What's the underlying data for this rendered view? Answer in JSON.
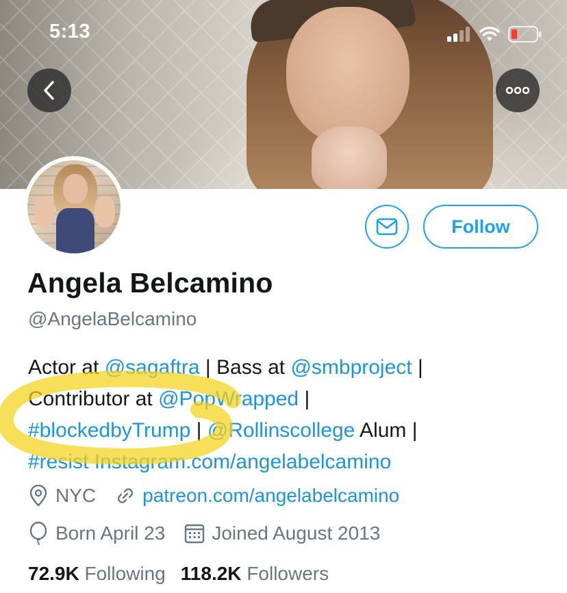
{
  "status_bar": {
    "time": "5:13"
  },
  "icons": {
    "back": "chevron-left-icon",
    "more": "more-horizontal-icon",
    "message": "envelope-icon",
    "location": "location-pin-icon",
    "link": "link-icon",
    "birthday": "balloon-icon",
    "joined": "calendar-icon",
    "signal": "signal-icon",
    "wifi": "wifi-icon",
    "battery": "battery-low-icon"
  },
  "colors": {
    "accent": "#1da1f2",
    "link": "#1b95e0",
    "secondary_text": "#657786",
    "highlighter": "#f5d21a",
    "battery_low": "#ff3b30"
  },
  "profile": {
    "name": "Angela Belcamino",
    "handle": "@AngelaBelcamino",
    "follow_label": "Follow",
    "bio": {
      "l1_a": "Actor at ",
      "l1_b": "@sagaftra",
      "l1_c": " | Bass at ",
      "l1_d": "@smbproject",
      "l1_e": " |",
      "l2_a": "Contributor at ",
      "l2_b": "@PopWrapped",
      "l2_c": " |",
      "l3_a": "#blockedbyTrump",
      "l3_b": " | ",
      "l3_c": "@Rollinscollege",
      "l3_d": " Alum |",
      "l4_a": "#resist",
      "l4_b": " ",
      "l4_c": "Instagram.com/angelabelcamino"
    },
    "location": "NYC",
    "website": "patreon.com/angelabelcamino",
    "birthday": "Born April 23",
    "joined": "Joined August 2013",
    "following_count": "72.9K",
    "following_label": "Following",
    "followers_count": "118.2K",
    "followers_label": "Followers"
  }
}
